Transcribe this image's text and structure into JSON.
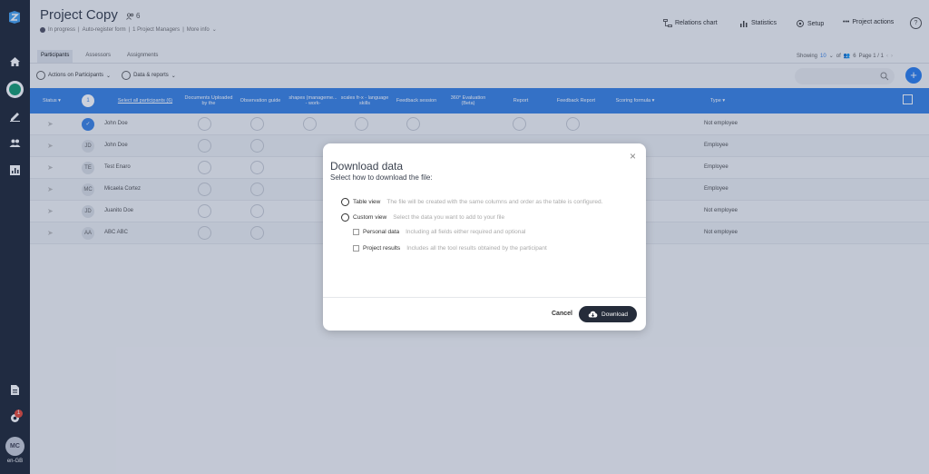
{
  "sidebar": {
    "language": "en-GB",
    "user_initials": "MC",
    "notification_count": "1"
  },
  "header": {
    "title": "Project Copy",
    "participant_count": "6",
    "status": "In progress",
    "sub_items": [
      "Auto-register form",
      "1 Project Managers",
      "More info"
    ],
    "actions": [
      "Relations chart",
      "Statistics",
      "Setup",
      "Project actions"
    ],
    "help": "?"
  },
  "tabs": [
    "Participants",
    "Assessors",
    "Assignments"
  ],
  "paging": {
    "showing_label": "Showing",
    "page_size": "10",
    "of_label": "of",
    "total": "6",
    "page_text": "Page 1 / 1"
  },
  "actions_bar": [
    "Actions on Participants",
    "Data & reports"
  ],
  "table": {
    "select_count": "1",
    "select_all_label": "Select all participants (6)",
    "columns": [
      "Status",
      "Documents Uploaded by the",
      "Observation guide",
      "shapes (manageme... - work-",
      "scales fr-x - language skills",
      "Feedback session",
      "360° Evaluation (Beta)",
      "Report",
      "Feedback Report",
      "Scoring formula",
      "Type"
    ],
    "rows": [
      {
        "initials": "",
        "name": "John Doe",
        "type": "Not employee",
        "checked": true
      },
      {
        "initials": "JD",
        "name": "John Doe",
        "type": "Employee",
        "checked": false
      },
      {
        "initials": "TE",
        "name": "Test Enaro",
        "type": "Employee",
        "checked": false
      },
      {
        "initials": "MC",
        "name": "Micaela Cortez",
        "type": "Employee",
        "checked": false
      },
      {
        "initials": "JD",
        "name": "Juanito Doe",
        "type": "Not employee",
        "checked": false
      },
      {
        "initials": "AA",
        "name": "ABC ABC",
        "type": "Not employee",
        "checked": false
      }
    ]
  },
  "modal": {
    "title": "Download data",
    "subtitle": "Select how to download the file:",
    "options": [
      {
        "label": "Table view",
        "hint": "The file will be created with the same columns and order as the table is configured."
      },
      {
        "label": "Custom view",
        "hint": "Select the data you want to add to your file"
      }
    ],
    "sub_options": [
      {
        "label": "Personal data",
        "hint": "Including all fields either required and optional"
      },
      {
        "label": "Project results",
        "hint": "Includes all the tool results obtained by the participant"
      }
    ],
    "cancel_label": "Cancel",
    "download_label": "Download"
  }
}
